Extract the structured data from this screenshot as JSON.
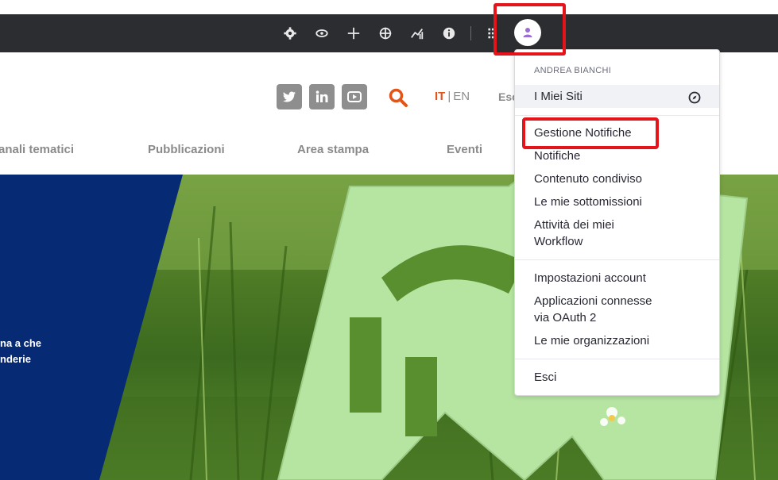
{
  "admin_bar": {
    "icons": [
      "gear-icon",
      "eye-icon",
      "plus-icon",
      "simulation-icon",
      "analytics-icon",
      "info-icon",
      "apps-grid-icon"
    ],
    "avatar_icon": "user-icon"
  },
  "header": {
    "social": [
      "twitter-icon",
      "linkedin-icon",
      "youtube-icon"
    ],
    "search_icon": "search-icon",
    "lang_active": "IT",
    "lang_sep": "|",
    "lang_other": "EN",
    "esci_partial": "Esc"
  },
  "nav": {
    "items": [
      "anali tematici",
      "Pubblicazioni",
      "Area stampa",
      "Eventi"
    ]
  },
  "hero": {
    "line1": "na a che",
    "line2": "nderie"
  },
  "user_menu": {
    "user_name": "ANDREA BIANCHI",
    "my_sites": "I Miei Siti",
    "items_1": [
      "Gestione Notifiche",
      "Notifiche",
      "Contenuto condiviso",
      "Le mie sottomissioni"
    ],
    "workflow_line1": "Attività dei miei",
    "workflow_line2": "Workflow",
    "account_settings": "Impostazioni account",
    "oauth_line1": "Applicazioni connesse",
    "oauth_line2": "via OAuth 2",
    "organizations": "Le mie organizzazioni",
    "logout": "Esci"
  },
  "colors": {
    "admin_bar": "#2c2d31",
    "accent_orange": "#e0561a",
    "hero_blue": "#062a73",
    "annotation_red": "#e5141b"
  }
}
